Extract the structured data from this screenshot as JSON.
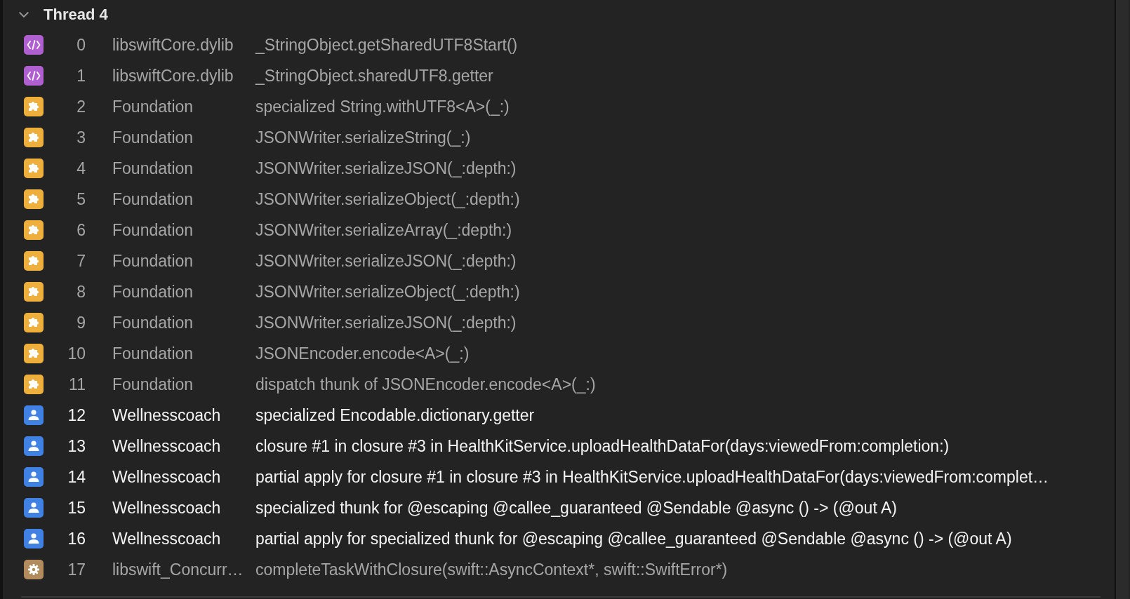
{
  "thread": {
    "title": "Thread 4",
    "expanded": true
  },
  "frames": [
    {
      "kind": "code",
      "index": "0",
      "library": "libswiftCore.dylib",
      "symbol": "_StringObject.getSharedUTF8Start()"
    },
    {
      "kind": "code",
      "index": "1",
      "library": "libswiftCore.dylib",
      "symbol": "_StringObject.sharedUTF8.getter"
    },
    {
      "kind": "framework",
      "index": "2",
      "library": "Foundation",
      "symbol": "specialized String.withUTF8<A>(_:)"
    },
    {
      "kind": "framework",
      "index": "3",
      "library": "Foundation",
      "symbol": "JSONWriter.serializeString(_:)"
    },
    {
      "kind": "framework",
      "index": "4",
      "library": "Foundation",
      "symbol": "JSONWriter.serializeJSON(_:depth:)"
    },
    {
      "kind": "framework",
      "index": "5",
      "library": "Foundation",
      "symbol": "JSONWriter.serializeObject(_:depth:)"
    },
    {
      "kind": "framework",
      "index": "6",
      "library": "Foundation",
      "symbol": "JSONWriter.serializeArray(_:depth:)"
    },
    {
      "kind": "framework",
      "index": "7",
      "library": "Foundation",
      "symbol": "JSONWriter.serializeJSON(_:depth:)"
    },
    {
      "kind": "framework",
      "index": "8",
      "library": "Foundation",
      "symbol": "JSONWriter.serializeObject(_:depth:)"
    },
    {
      "kind": "framework",
      "index": "9",
      "library": "Foundation",
      "symbol": "JSONWriter.serializeJSON(_:depth:)"
    },
    {
      "kind": "framework",
      "index": "10",
      "library": "Foundation",
      "symbol": "JSONEncoder.encode<A>(_:)"
    },
    {
      "kind": "framework",
      "index": "11",
      "library": "Foundation",
      "symbol": "dispatch thunk of JSONEncoder.encode<A>(_:)"
    },
    {
      "kind": "user",
      "index": "12",
      "library": "Wellnesscoach",
      "symbol": "specialized Encodable.dictionary.getter"
    },
    {
      "kind": "user",
      "index": "13",
      "library": "Wellnesscoach",
      "symbol": "closure #1 in closure #3 in HealthKitService.uploadHealthDataFor(days:viewedFrom:completion:)"
    },
    {
      "kind": "user",
      "index": "14",
      "library": "Wellnesscoach",
      "symbol": "partial apply for closure #1 in closure #3 in HealthKitService.uploadHealthDataFor(days:viewedFrom:complet…"
    },
    {
      "kind": "user",
      "index": "15",
      "library": "Wellnesscoach",
      "symbol": "specialized thunk for @escaping @callee_guaranteed @Sendable @async () -> (@out A)"
    },
    {
      "kind": "user",
      "index": "16",
      "library": "Wellnesscoach",
      "symbol": "partial apply for specialized thunk for @escaping @callee_guaranteed @Sendable @async () -> (@out A)"
    },
    {
      "kind": "runtime",
      "index": "17",
      "library": "libswift_Concurr…",
      "symbol": "completeTaskWithClosure(swift::AsyncContext*, swift::SwiftError*)"
    }
  ]
}
